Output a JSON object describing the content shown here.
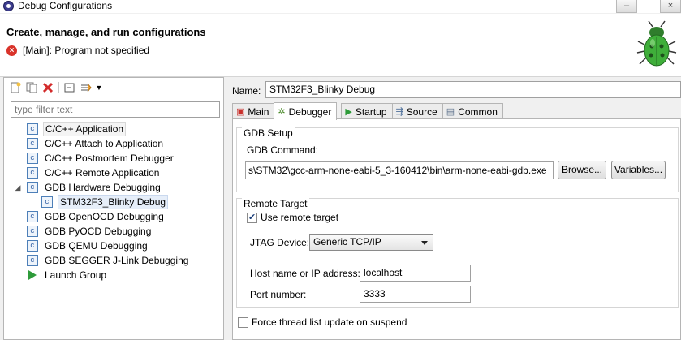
{
  "window": {
    "title": "Debug Configurations",
    "controls": [
      "–",
      "×"
    ]
  },
  "header": {
    "title": "Create, manage, and run configurations",
    "error_message": "[Main]: Program not specified"
  },
  "left": {
    "filter_placeholder": "type filter text",
    "tree": [
      {
        "label": "C/C++ Application",
        "icon": "c-config-icon"
      },
      {
        "label": "C/C++ Attach to Application",
        "icon": "c-config-icon"
      },
      {
        "label": "C/C++ Postmortem Debugger",
        "icon": "c-config-icon"
      },
      {
        "label": "C/C++ Remote Application",
        "icon": "c-config-icon"
      },
      {
        "label": "GDB Hardware Debugging",
        "icon": "c-config-icon",
        "expanded": true
      },
      {
        "label": "STM32F3_Blinky Debug",
        "icon": "c-config-icon",
        "selected": true
      },
      {
        "label": "GDB OpenOCD Debugging",
        "icon": "c-config-icon"
      },
      {
        "label": "GDB PyOCD Debugging",
        "icon": "c-config-icon"
      },
      {
        "label": "GDB QEMU Debugging",
        "icon": "c-config-icon"
      },
      {
        "label": "GDB SEGGER J-Link Debugging",
        "icon": "c-config-icon"
      },
      {
        "label": "Launch Group",
        "icon": "launch-group-icon"
      }
    ],
    "icon_glyph": "c"
  },
  "right": {
    "name_label": "Name:",
    "name_value": "STM32F3_Blinky Debug",
    "tabs": [
      {
        "label": "Main",
        "icon": "main-tab-icon"
      },
      {
        "label": "Debugger",
        "icon": "debugger-tab-icon",
        "active": true
      },
      {
        "label": "Startup",
        "icon": "startup-tab-icon"
      },
      {
        "label": "Source",
        "icon": "source-tab-icon"
      },
      {
        "label": "Common",
        "icon": "common-tab-icon"
      }
    ],
    "gdb_setup": {
      "group_title": "GDB Setup",
      "command_label": "GDB Command:",
      "command_value": "s\\STM32\\gcc-arm-none-eabi-5_3-160412\\bin\\arm-none-eabi-gdb.exe",
      "browse_label": "Browse...",
      "variables_label": "Variables..."
    },
    "remote_target": {
      "group_title": "Remote Target",
      "use_remote_label": "Use remote target",
      "use_remote_checked": true,
      "jtag_label": "JTAG Device:",
      "jtag_value": "Generic TCP/IP",
      "host_label": "Host name or IP address:",
      "host_value": "localhost",
      "port_label": "Port number:",
      "port_value": "3333"
    },
    "force_thread_label": "Force thread list update on suspend",
    "force_thread_checked": false
  },
  "colors": {
    "error": "#d9332a",
    "launch_green": "#2e9b3a",
    "bug_green": "#3fae3a"
  }
}
